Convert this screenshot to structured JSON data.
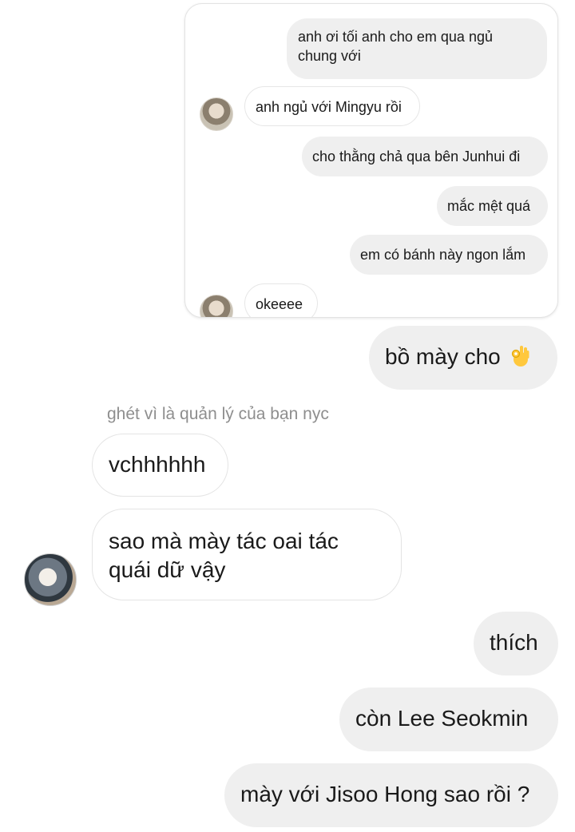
{
  "quoted_card": {
    "messages": [
      {
        "side": "right",
        "text": "anh ơi tối anh cho em qua ngủ chung với"
      },
      {
        "side": "left",
        "text": "anh ngủ với Mingyu rồi"
      },
      {
        "side": "right",
        "text": "cho thằng chả qua bên Junhui đi"
      },
      {
        "side": "right",
        "text": "mắc mệt quá"
      },
      {
        "side": "right",
        "text": "em có bánh này ngon lắm"
      },
      {
        "side": "left",
        "text": "okeeee"
      }
    ]
  },
  "chat": {
    "msg_1": {
      "side": "right",
      "text": "bồ mày cho",
      "emoji": "ok-hand-icon"
    },
    "caption": "ghét vì là quản lý của bạn nyc",
    "msg_2": {
      "side": "left",
      "text": "vchhhhhh"
    },
    "msg_3": {
      "side": "left",
      "text": "sao mà mày tác oai tác quái dữ vậy"
    },
    "msg_4": {
      "side": "right",
      "text": "thích"
    },
    "msg_5": {
      "side": "right",
      "text": "còn Lee Seokmin"
    },
    "msg_6": {
      "side": "right",
      "text": "mày với Jisoo Hong sao rồi ?"
    }
  },
  "colors": {
    "outgoing_bubble": "#efefef",
    "incoming_bubble_border": "#e4e4e4",
    "caption_text": "#8e8e8e"
  }
}
